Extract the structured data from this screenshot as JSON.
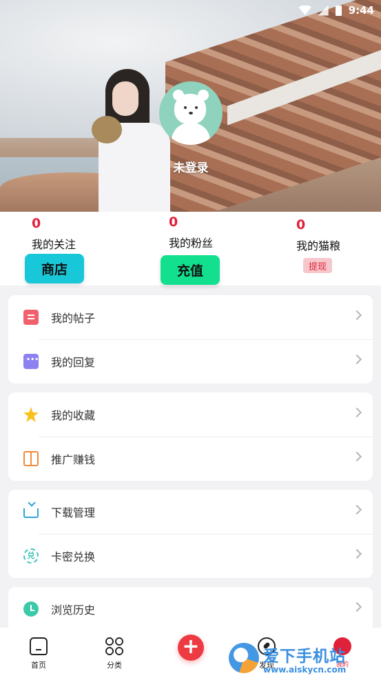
{
  "status_bar": {
    "time": "9:44"
  },
  "profile": {
    "login_text": "未登录"
  },
  "stats": {
    "following": {
      "count": "0",
      "label": "我的关注"
    },
    "fans": {
      "count": "0",
      "label": "我的粉丝"
    },
    "cat_food": {
      "count": "0",
      "label": "我的猫粮"
    },
    "shop_label": "商店",
    "recharge_label": "充值",
    "withdraw_label": "提现"
  },
  "menu": {
    "group1": [
      {
        "label": "我的帖子",
        "icon": "post-icon"
      },
      {
        "label": "我的回复",
        "icon": "reply-icon"
      }
    ],
    "group2": [
      {
        "label": "我的收藏",
        "icon": "star-icon"
      },
      {
        "label": "推广赚钱",
        "icon": "gift-icon"
      }
    ],
    "group3": [
      {
        "label": "下载管理",
        "icon": "download-icon"
      },
      {
        "label": "卡密兑换",
        "icon": "redeem-icon",
        "glyph": "兑"
      }
    ],
    "group4": [
      {
        "label": "浏览历史",
        "icon": "clock-icon"
      }
    ]
  },
  "nav": {
    "home": "首页",
    "category": "分类",
    "plus": "+",
    "discover": "发现",
    "me": "我的"
  },
  "watermark": {
    "title": "爱下手机站",
    "url": "www.aiskycn.com"
  },
  "colors": {
    "accent_red": "#e0213a",
    "shop_btn": "#18c7d8",
    "recharge_btn": "#13e08e"
  }
}
